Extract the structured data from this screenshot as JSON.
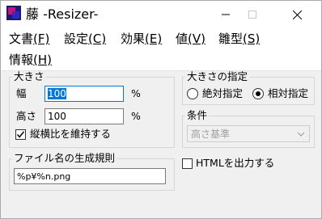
{
  "window": {
    "title": "藤 -Resizer-"
  },
  "menu": {
    "items": [
      {
        "label": "文書",
        "accel": "(F)"
      },
      {
        "label": "設定",
        "accel": "(C)"
      },
      {
        "label": "効果",
        "accel": "(E)"
      },
      {
        "label": "値",
        "accel": "(V)"
      },
      {
        "label": "雛型",
        "accel": "(S)"
      },
      {
        "label": "情報",
        "accel": "(H)"
      }
    ]
  },
  "size_group": {
    "legend": "大きさ",
    "width_label": "幅",
    "width_value": "100",
    "width_unit": "%",
    "height_label": "高さ",
    "height_value": "100",
    "height_unit": "%",
    "keep_ratio_label": "縦横比を維持する",
    "keep_ratio_checked": true
  },
  "size_spec_group": {
    "legend": "大きさの指定",
    "absolute_label": "絶対指定",
    "relative_label": "相対指定",
    "selected": "relative"
  },
  "condition_group": {
    "legend": "条件",
    "selected_value": "高さ基準"
  },
  "filename_group": {
    "legend": "ファイル名の生成規則",
    "value": "%p¥%n.png"
  },
  "html_output": {
    "label": "HTMLを出力する",
    "checked": false
  },
  "colors": {
    "accent": "#0078d7",
    "disabled_text": "#a0a0a0"
  }
}
